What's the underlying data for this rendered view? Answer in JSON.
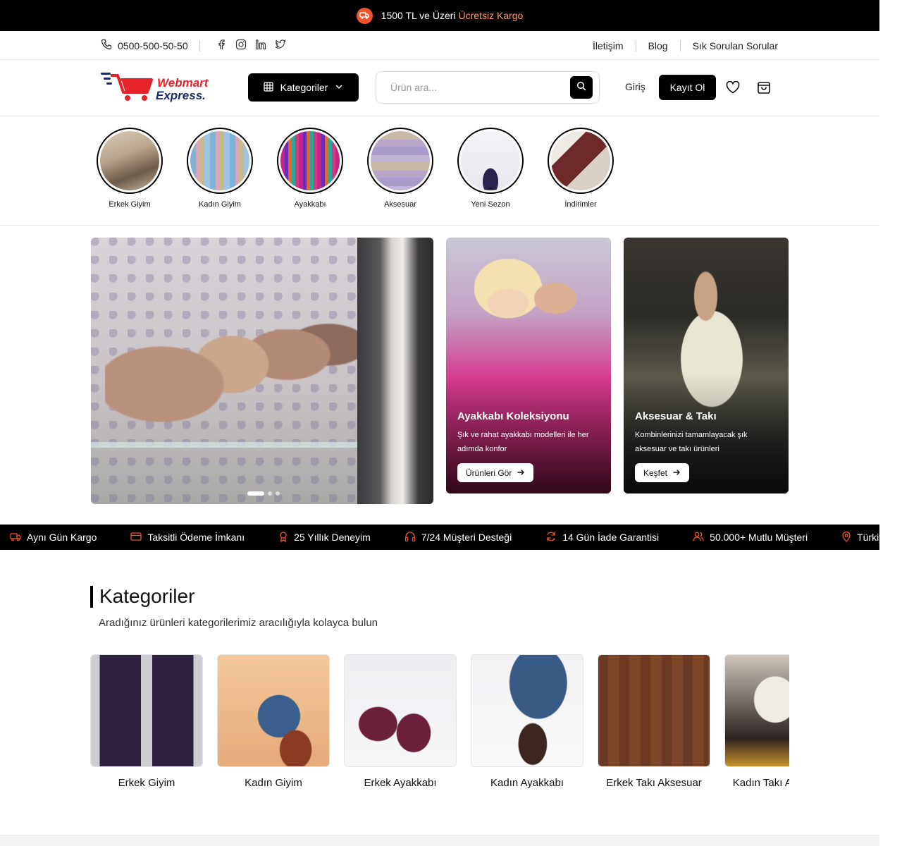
{
  "announcement": {
    "text": "1500 TL ve Üzeri",
    "accent": "Ücretsiz Kargo"
  },
  "topbar": {
    "phone": "0500-500-50-50",
    "links": [
      "İletişim",
      "Blog",
      "Sık Sorulan Sorular"
    ]
  },
  "header": {
    "logo_line1": "Webmart",
    "logo_line2": "Express.",
    "categories_button": "Kategoriler",
    "search_placeholder": "Ürün ara...",
    "login": "Giriş",
    "register": "Kayıt Ol"
  },
  "stories": [
    "Erkek Giyim",
    "Kadın Giyim",
    "Ayakkabı",
    "Aksesuar",
    "Yeni Sezon",
    "İndirimler"
  ],
  "promos": [
    {
      "title": "Ayakkabı Koleksiyonu",
      "desc": "Şık ve rahat ayakkabı modelleri ile her adımda konfor",
      "button": "Ürünleri Gör"
    },
    {
      "title": "Aksesuar & Takı",
      "desc": "Kombinlerinizi tamamlayacak şık aksesuar ve takı ürünleri",
      "button": "Keşfet"
    }
  ],
  "features": [
    "Aynı Gün Kargo",
    "Taksitli Ödeme İmkanı",
    "25 Yıllık Deneyim",
    "7/24 Müşteri Desteği",
    "14 Gün İade Garantisi",
    "50.000+ Mutlu Müşteri",
    "Türkiye Geneli Teslimat"
  ],
  "categories": {
    "title": "Kategoriler",
    "subtitle": "Aradığınız ürünleri kategorilerimiz aracılığıyla kolayca bulun",
    "items": [
      "Erkek Giyim",
      "Kadın Giyim",
      "Erkek Ayakkabı",
      "Kadın Ayakkabı",
      "Erkek Takı Aksesuar",
      "Kadın Takı Aksesuar"
    ]
  },
  "colors": {
    "accent": "#f2542d",
    "accent_text": "#ff9a6b",
    "dark": "#000000"
  }
}
